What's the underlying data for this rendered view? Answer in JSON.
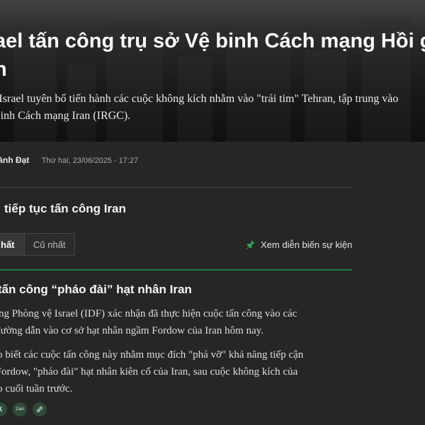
{
  "article": {
    "title_line1": "ael tấn công trụ sở Vệ binh Cách mạng Hồi g",
    "title_line2": "n",
    "lede_line1": "rí) - Israel tuyên bố tiến hành các cuộc không kích nhằm vào \"trái tim\" Tehran, tập trung vào",
    "lede_line2": "Vệ binh Cách mạng Iran (IRGC).",
    "author": "hành Đạt",
    "published": "Thứ hai, 23/06/2025 - 17:27"
  },
  "live": {
    "section_title": "tiếp tục tấn công Iran",
    "tabs": [
      {
        "label": "hất",
        "active": true
      },
      {
        "label": "Cũ nhất",
        "active": false
      }
    ],
    "timeline_link": "Xem diễn biến sự kiện",
    "accent_color": "#1f7c3f"
  },
  "post": {
    "title": "el tấn công “pháo đài” hạt nhân Iran",
    "p1_line1": "ượng Phòng vệ Israel (IDF) xác nhận đã thực hiện cuộc tấn công vào các",
    "p1_line2": "n đường dẫn vào cơ sở hạt nhân ngầm Fordow của Iran hôm nay.",
    "p2_line1": "cho biết các cuộc tấn công này nhằm mục đích \"phá vỡ\" khả năng tiếp cận",
    "p2_line2": "ở Fordow, \"pháo đài\" hạt nhân kiên cố của Iran, sau cuộc không kích của",
    "p2_line3": "vào cuối tuần trước."
  },
  "share": {
    "x_label": "X",
    "zalo_label": "Zalo",
    "icons": [
      "x-icon",
      "zalo-icon",
      "link-icon"
    ]
  }
}
